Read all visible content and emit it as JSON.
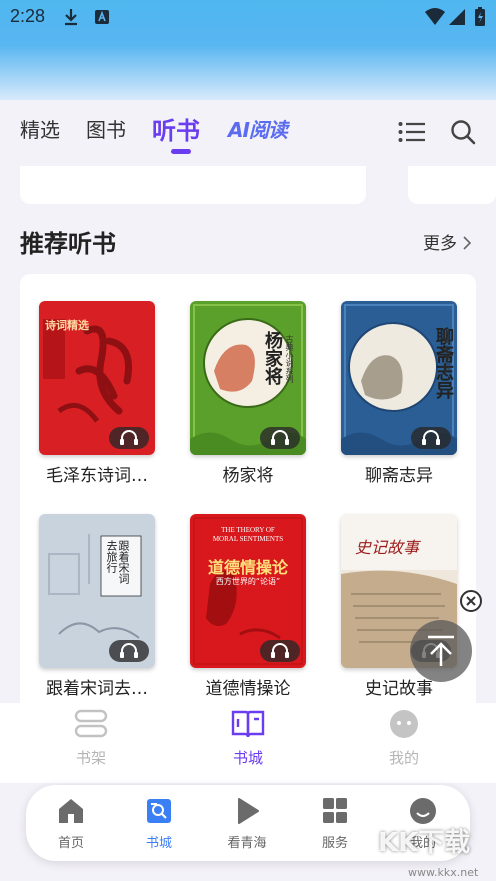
{
  "status": {
    "time": "2:28"
  },
  "topnav": {
    "tabs": [
      "精选",
      "图书",
      "听书"
    ],
    "ai_tab": "AI阅读"
  },
  "section": {
    "title": "推荐听书",
    "more": "更多"
  },
  "books": [
    {
      "title": "毛泽东诗词…",
      "cover_text": "诗词精选"
    },
    {
      "title": "杨家将",
      "cover_text": "杨家将",
      "cover_sub": "古典小说系列"
    },
    {
      "title": "聊斋志异",
      "cover_text": "聊斋志异",
      "cover_sub": "古典小说系列"
    },
    {
      "title": "跟着宋词去…",
      "cover_text": "跟着宋词去旅行"
    },
    {
      "title": "道德情操论",
      "cover_text": "道德情操论",
      "cover_en1": "THE THEORY OF",
      "cover_en2": "MORAL SENTIMENTS",
      "cover_sub": "西方世界的“论语”"
    },
    {
      "title": "史记故事",
      "cover_text": "史记故事"
    }
  ],
  "bottom_tabs": [
    {
      "label": "书架",
      "icon": "bookshelf-icon"
    },
    {
      "label": "书城",
      "icon": "bookstore-icon"
    },
    {
      "label": "我的",
      "icon": "profile-icon"
    }
  ],
  "float_nav": [
    {
      "label": "首页",
      "icon": "home-icon"
    },
    {
      "label": "书城",
      "icon": "bookstore-search-icon"
    },
    {
      "label": "看青海",
      "icon": "play-icon"
    },
    {
      "label": "服务",
      "icon": "grid-icon"
    },
    {
      "label": "我的",
      "icon": "smile-icon"
    }
  ],
  "watermark": {
    "text": "KK下载",
    "url": "www.kkx.net"
  },
  "colors": {
    "accent": "#6a3df0",
    "accent_blue": "#3b7ff5"
  }
}
